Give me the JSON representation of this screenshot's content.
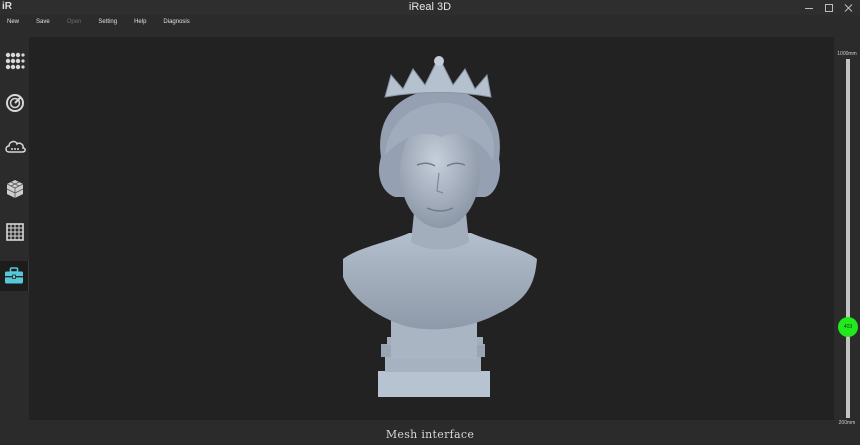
{
  "window": {
    "logo_text": "iR",
    "title": "iReal 3D"
  },
  "menu": {
    "items": [
      {
        "label": "New",
        "enabled": true
      },
      {
        "label": "Save",
        "enabled": true
      },
      {
        "label": "Open",
        "enabled": false
      },
      {
        "label": "Setting",
        "enabled": true
      },
      {
        "label": "Help",
        "enabled": true
      },
      {
        "label": "Diagnosis",
        "enabled": true
      }
    ]
  },
  "sidebar": {
    "items": [
      {
        "icon": "dot-grid-icon",
        "active": false
      },
      {
        "icon": "scan-dial-icon",
        "active": false
      },
      {
        "icon": "cloud-icon",
        "active": false
      },
      {
        "icon": "mesh-cube-icon",
        "active": false
      },
      {
        "icon": "grid-square-icon",
        "active": false
      },
      {
        "icon": "toolbox-icon",
        "active": true
      }
    ],
    "active_color": "#58c8d8"
  },
  "distance_slider": {
    "max_label": "1000mm",
    "min_label": "200mm",
    "value_label": "403",
    "min": 200,
    "max": 1000,
    "value": 403,
    "knob_color": "#22e81e"
  },
  "status": {
    "text": "Mesh interface"
  },
  "colors": {
    "background": "#222222",
    "panel": "#2b2b2b",
    "model": "#a9b4c4"
  }
}
